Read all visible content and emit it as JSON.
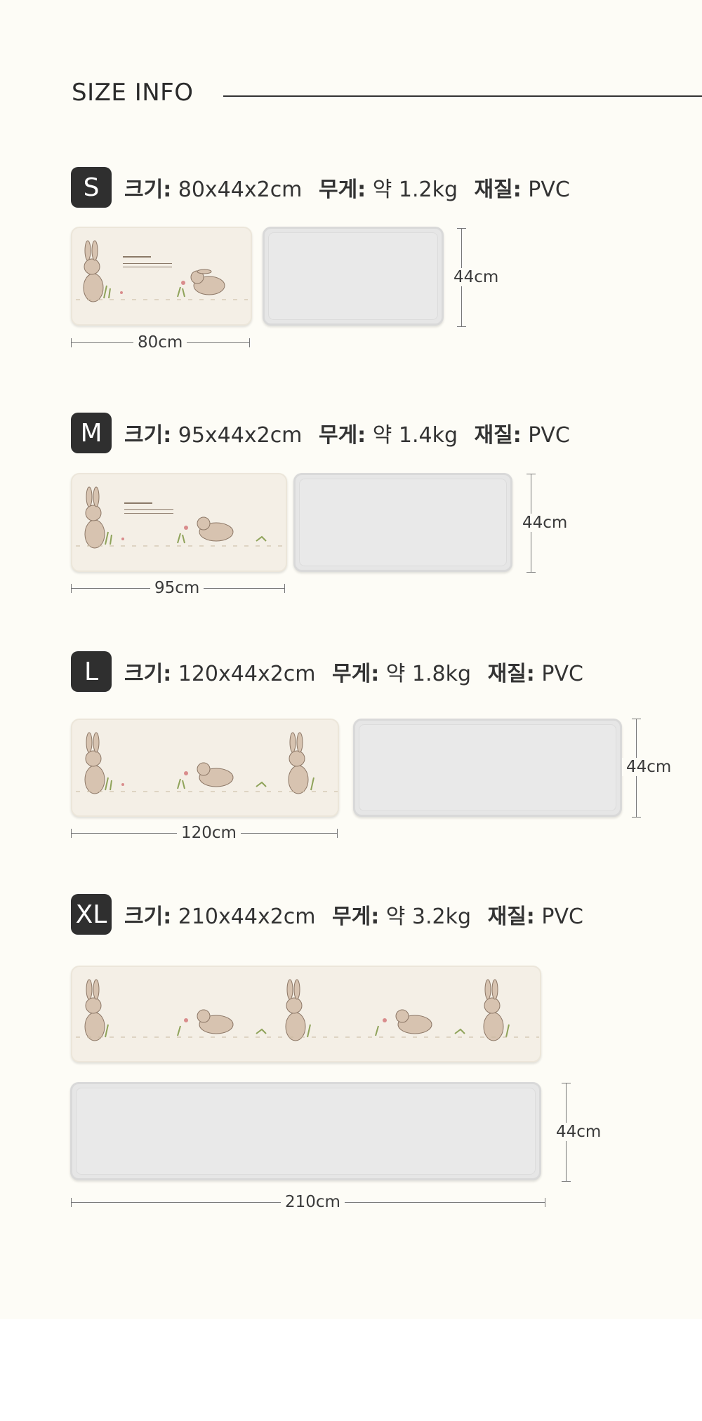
{
  "header": {
    "title": "SIZE INFO"
  },
  "labels": {
    "size": "크기:",
    "weight": "무게:",
    "material": "재질:"
  },
  "sizes": [
    {
      "badge": "S",
      "size": "80x44x2cm",
      "weight": "약 1.2kg",
      "material": "PVC",
      "length": "80cm",
      "height": "44cm"
    },
    {
      "badge": "M",
      "size": "95x44x2cm",
      "weight": "약 1.4kg",
      "material": "PVC",
      "length": "95cm",
      "height": "44cm"
    },
    {
      "badge": "L",
      "size": "120x44x2cm",
      "weight": "약 1.8kg",
      "material": "PVC",
      "length": "120cm",
      "height": "44cm"
    },
    {
      "badge": "XL",
      "size": "210x44x2cm",
      "weight": "약 3.2kg",
      "material": "PVC",
      "length": "210cm",
      "height": "44cm"
    }
  ],
  "colors": {
    "background": "#fdfcf6",
    "badge": "#2f2f2f",
    "print_mat": "#f4efe6",
    "plain_mat": "#e6e6e6"
  }
}
